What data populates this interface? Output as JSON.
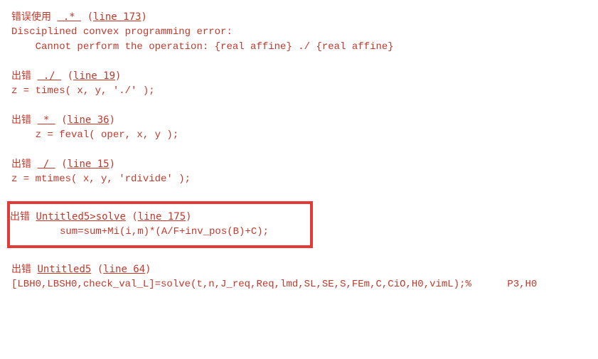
{
  "errors": [
    {
      "label": "错误使用 ",
      "func": " .* ",
      "line_text": "line 173",
      "detail_lines": [
        "Disciplined convex programming error:",
        "    Cannot perform the operation: {real affine} ./ {real affine}"
      ]
    },
    {
      "label": "出错 ",
      "func": " ./ ",
      "line_text": "line 19",
      "detail_lines": [
        "z = times( x, y, './' );"
      ]
    },
    {
      "label": "出错 ",
      "func": " * ",
      "line_text": "line 36",
      "detail_lines": [
        "    z = feval( oper, x, y );"
      ]
    },
    {
      "label": "出错 ",
      "func": " / ",
      "line_text": "line 15",
      "detail_lines": [
        "z = mtimes( x, y, 'rdivide' );"
      ]
    },
    {
      "label": "出错 ",
      "func": "Untitled5>solve",
      "line_text": "line 175",
      "detail_lines": [
        "sum=sum+Mi(i,m)*(A/F+inv_pos(B)+C);"
      ],
      "highlighted": true
    },
    {
      "label": "出错 ",
      "func": "Untitled5",
      "line_text": "line 64",
      "detail_lines": [
        "[LBH0,LBSH0,check_val_L]=solve(t,n,J_req,Req,lmd,SL,SE,S,FEm,C,CiO,H0,vimL);%      P3,H0"
      ]
    }
  ],
  "paren_open": " (",
  "paren_close": ")"
}
